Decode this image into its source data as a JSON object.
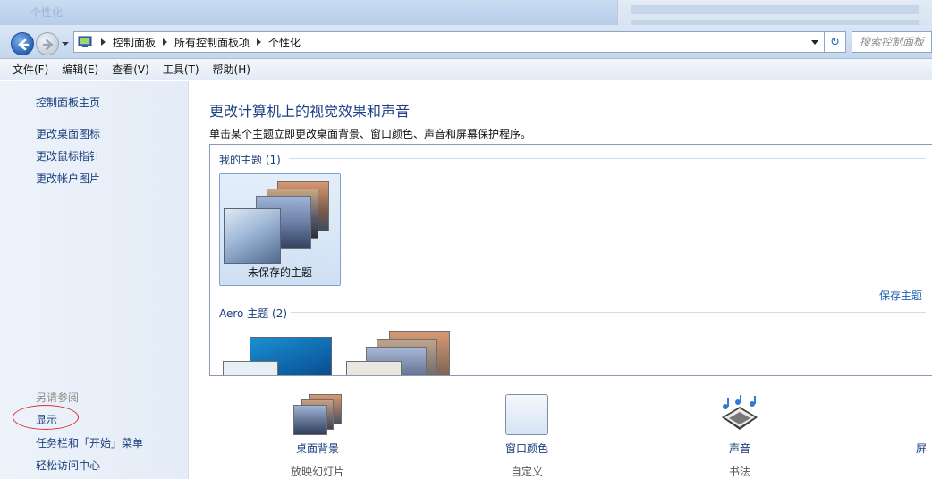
{
  "window": {
    "ghost_title": "个性化"
  },
  "nav": {
    "crumbs": [
      "控制面板",
      "所有控制面板项",
      "个性化"
    ],
    "refresh_symbol": "↻",
    "search_placeholder": "搜索控制面板"
  },
  "menu": [
    "文件(F)",
    "编辑(E)",
    "查看(V)",
    "工具(T)",
    "帮助(H)"
  ],
  "sidebar": {
    "home": "控制面板主页",
    "links": [
      "更改桌面图标",
      "更改鼠标指针",
      "更改帐户图片"
    ],
    "see_also": "另请参阅",
    "see_also_links": [
      "显示",
      "任务栏和「开始」菜单",
      "轻松访问中心"
    ]
  },
  "main": {
    "title": "更改计算机上的视觉效果和声音",
    "subtitle": "单击某个主题立即更改桌面背景、窗口颜色、声音和屏幕保护程序。",
    "my_themes": {
      "header": "我的主题 (1)",
      "items": [
        {
          "label": "未保存的主题"
        }
      ]
    },
    "save_theme": "保存主题",
    "aero_themes": {
      "header": "Aero 主题 (2)"
    }
  },
  "bottom_options": [
    {
      "label": "桌面背景",
      "sub": "放映幻灯片",
      "icon": "desktop-background-icon"
    },
    {
      "label": "窗口颜色",
      "sub": "自定义",
      "icon": "window-color-icon"
    },
    {
      "label": "声音",
      "sub": "书法",
      "icon": "sound-icon"
    },
    {
      "label": "屏",
      "sub": "",
      "icon": "screensaver-icon"
    }
  ],
  "colors": {
    "link": "#1a3e7c",
    "heading": "#1c3f86",
    "annotation_circle": "#e0302f"
  }
}
